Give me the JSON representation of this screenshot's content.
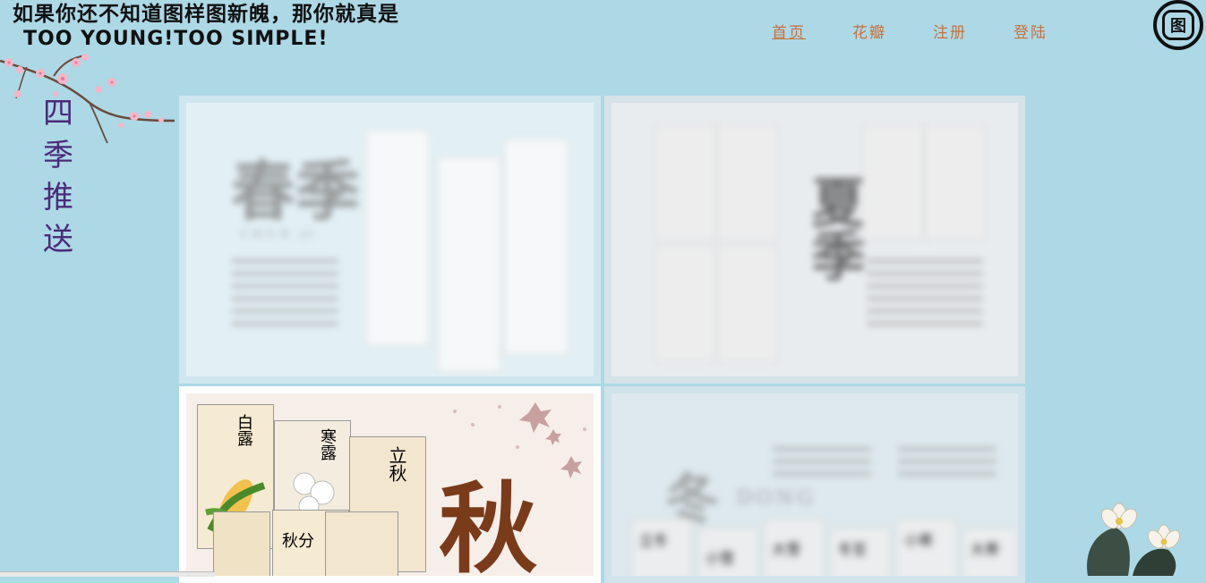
{
  "header": {
    "slogan_line1": "如果你还不知道图样图新魄，那你就真是",
    "slogan_line2": "TOO YOUNG!TOO SIMPLE!",
    "logo_char": "图"
  },
  "nav": {
    "items": [
      {
        "label": "首页",
        "active": true
      },
      {
        "label": "花瓣",
        "active": false
      },
      {
        "label": "注册",
        "active": false
      },
      {
        "label": "登陆",
        "active": false
      }
    ]
  },
  "sidebar": {
    "title_chars": [
      "四",
      "季",
      "推",
      "送"
    ]
  },
  "gallery": {
    "tiles": [
      {
        "season": "春季",
        "caption": "CHUN JI",
        "blurred": true
      },
      {
        "season": "夏季",
        "caption": "",
        "blurred": true
      },
      {
        "season": "秋",
        "cards": [
          "白露",
          "寒露",
          "立秋",
          "秋分"
        ],
        "blurred": false
      },
      {
        "season": "冬",
        "caption": "DONG",
        "cards": [
          "立冬",
          "小雪",
          "大雪",
          "冬至",
          "小寒",
          "大寒"
        ],
        "blurred": true
      }
    ]
  },
  "colors": {
    "background": "#add8e6",
    "nav_text": "#c8703a",
    "side_title": "#4b2a7a"
  }
}
